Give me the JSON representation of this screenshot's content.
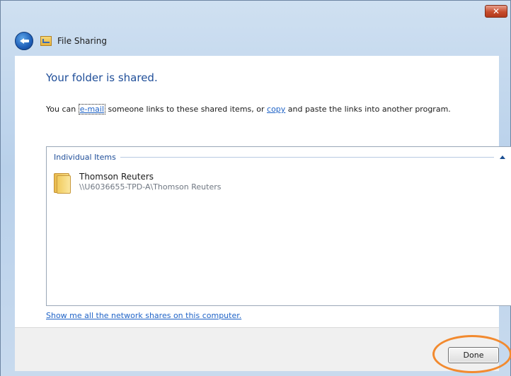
{
  "window": {
    "title": "File Sharing",
    "close_glyph": "✕",
    "close_icon": "close-icon",
    "back_icon": "back-arrow-icon",
    "title_icon": "file-sharing-icon"
  },
  "content": {
    "heading": "Your folder is shared.",
    "instruction": {
      "prefix": "You can ",
      "email_link": "e-mail",
      "middle": " someone links to these shared items, or ",
      "copy_link": "copy",
      "suffix": " and paste the links into another program."
    },
    "group": {
      "label": "Individual Items",
      "collapse_icon": "chevron-up-icon"
    },
    "items": [
      {
        "name": "Thomson Reuters",
        "path": "\\\\U6036655-TPD-A\\Thomson Reuters",
        "icon": "folder-icon"
      }
    ],
    "network_link": "Show me all the network shares on this computer."
  },
  "footer": {
    "done_label": "Done",
    "highlight_color": "#f28a2f"
  },
  "colors": {
    "heading": "#1f4e99",
    "link": "#1f63c7",
    "frame": "#c8daee"
  }
}
